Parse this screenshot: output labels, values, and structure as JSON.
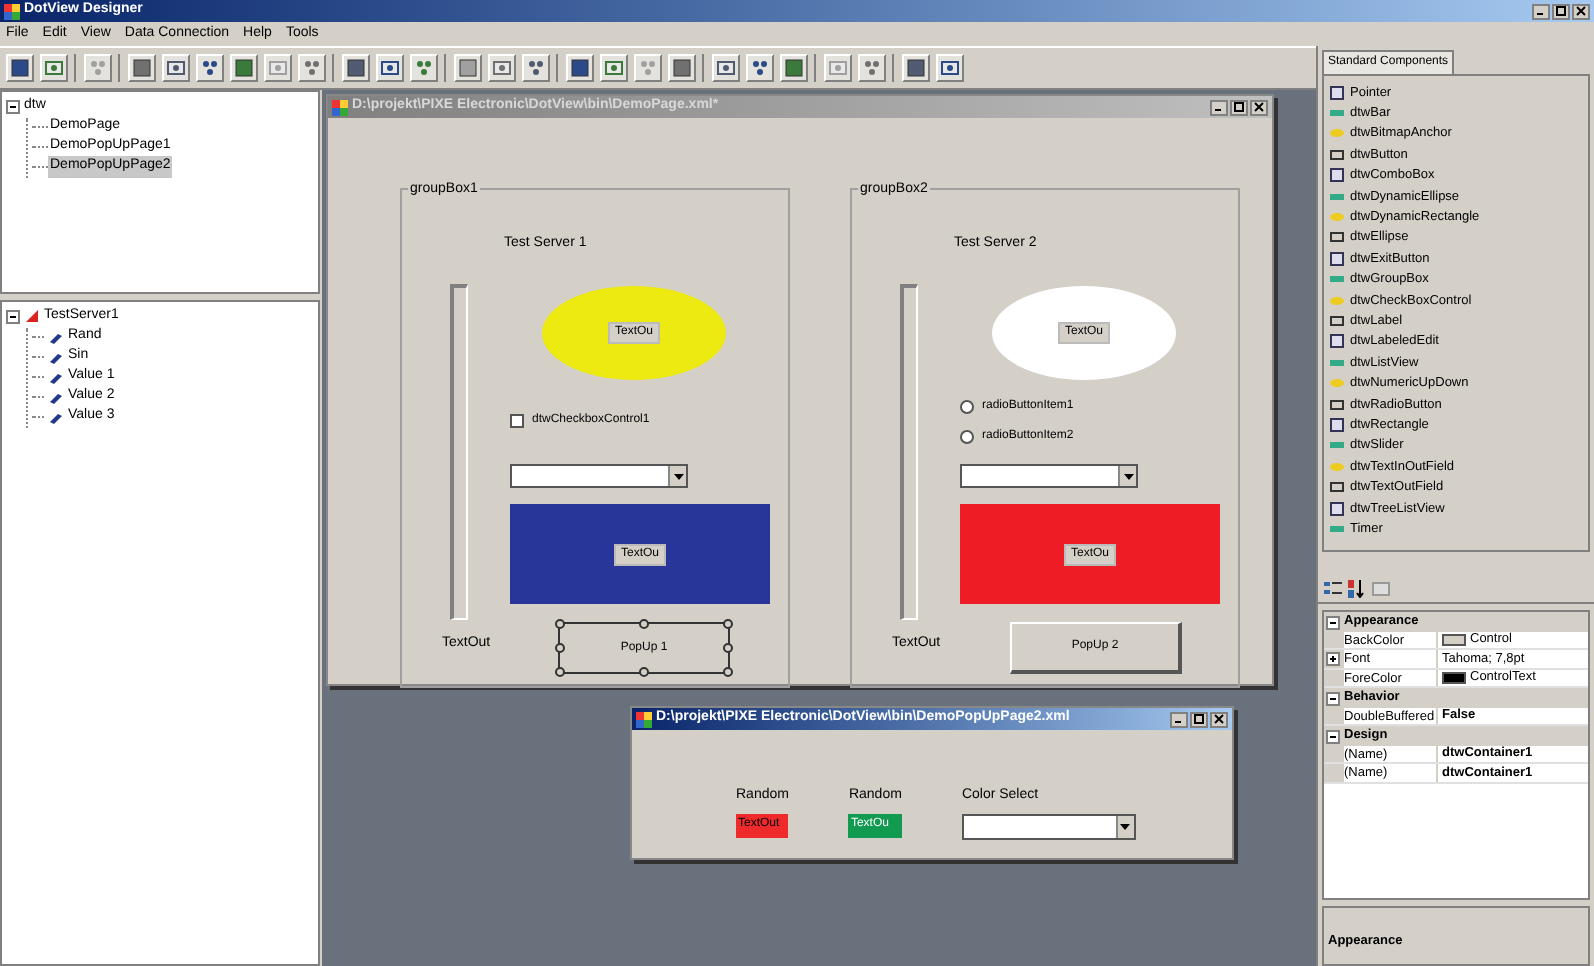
{
  "window": {
    "title": "DotView Designer"
  },
  "menu": [
    "File",
    "Edit",
    "View",
    "Data Connection",
    "Help",
    "Tools"
  ],
  "page_tree": [
    {
      "label": "dtw",
      "expanded": true,
      "selected": false,
      "children": [
        {
          "label": "DemoPage",
          "selected": false
        },
        {
          "label": "DemoPopUpPage1",
          "selected": false
        },
        {
          "label": "DemoPopUpPage2",
          "selected": true
        }
      ]
    }
  ],
  "server_tree": [
    {
      "label": "TestServer1",
      "expanded": true,
      "children": [
        {
          "label": "Rand"
        },
        {
          "label": "Sin"
        },
        {
          "label": "Value 1"
        },
        {
          "label": "Value 2"
        },
        {
          "label": "Value 3"
        }
      ]
    }
  ],
  "page_window": {
    "title": "D:\\projekt\\PIXE Electronic\\DotView\\bin\\DemoPage.xml*",
    "active": false,
    "groups": [
      {
        "title": "groupBox1",
        "server_label": "Test Server 1",
        "ellipse": {
          "color": "#ecea10",
          "label": "TextOu"
        },
        "options": [
          {
            "kind": "checkbox",
            "label": "dtwCheckboxControl1",
            "checked": false
          }
        ],
        "rect": {
          "color": "#28369a",
          "label": "TextOu"
        },
        "slider_label": "TextOut",
        "button": {
          "label": "PopUp 1",
          "selected": true
        }
      },
      {
        "title": "groupBox2",
        "server_label": "Test Server 2",
        "ellipse": {
          "color": "#ffffff",
          "label": "TextOu"
        },
        "options": [
          {
            "kind": "radio",
            "label": "radioButtonItem1",
            "checked": false
          },
          {
            "kind": "radio",
            "label": "radioButtonItem2",
            "checked": false
          }
        ],
        "rect": {
          "color": "#ee1c24",
          "label": "TextOu"
        },
        "slider_label": "TextOut",
        "button": {
          "label": "PopUp 2",
          "selected": false
        }
      }
    ]
  },
  "popup_window": {
    "title": "D:\\projekt\\PIXE Electronic\\DotView\\bin\\DemoPopUpPage2.xml",
    "active": true,
    "fields": [
      {
        "kind": "textout",
        "label": "Random",
        "value": "TextOut",
        "color": "#ee2a2a",
        "light_text": false
      },
      {
        "kind": "textout",
        "label": "Random",
        "value": "TextOu",
        "color": "#129a50",
        "light_text": true
      },
      {
        "kind": "combo",
        "label": "Color Select"
      }
    ]
  },
  "toolbox": {
    "tab": "Standard Components",
    "items": [
      "Pointer",
      "dtwBar",
      "dtwBitmapAnchor",
      "dtwButton",
      "dtwComboBox",
      "dtwDynamicEllipse",
      "dtwDynamicRectangle",
      "dtwEllipse",
      "dtwExitButton",
      "dtwGroupBox",
      "dtwCheckBoxControl",
      "dtwLabel",
      "dtwLabeledEdit",
      "dtwListView",
      "dtwNumericUpDown",
      "dtwRadioButton",
      "dtwRectangle",
      "dtwSlider",
      "dtwTextInOutField",
      "dtwTextOutField",
      "dtwTreeListView",
      "Timer"
    ]
  },
  "properties": [
    {
      "kind": "category",
      "label": "Appearance",
      "expanded": true
    },
    {
      "kind": "property",
      "label": "BackColor",
      "value": "Control",
      "color": "#d4d0c8",
      "bold": false
    },
    {
      "kind": "property",
      "label": "Font",
      "value": "Tahoma; 7,8pt",
      "expandable": true,
      "bold": false
    },
    {
      "kind": "property",
      "label": "ForeColor",
      "value": "ControlText",
      "color": "#000000",
      "bold": false
    },
    {
      "kind": "category",
      "label": "Behavior",
      "expanded": true
    },
    {
      "kind": "property",
      "label": "DoubleBuffered",
      "value": "False",
      "bold": true
    },
    {
      "kind": "category",
      "label": "Design",
      "expanded": true
    },
    {
      "kind": "property",
      "label": "(Name)",
      "value": "dtwContainer1",
      "bold": true
    },
    {
      "kind": "property",
      "label": "(Name)",
      "value": "dtwContainer1",
      "bold": true
    }
  ],
  "description": {
    "title": "Appearance"
  }
}
